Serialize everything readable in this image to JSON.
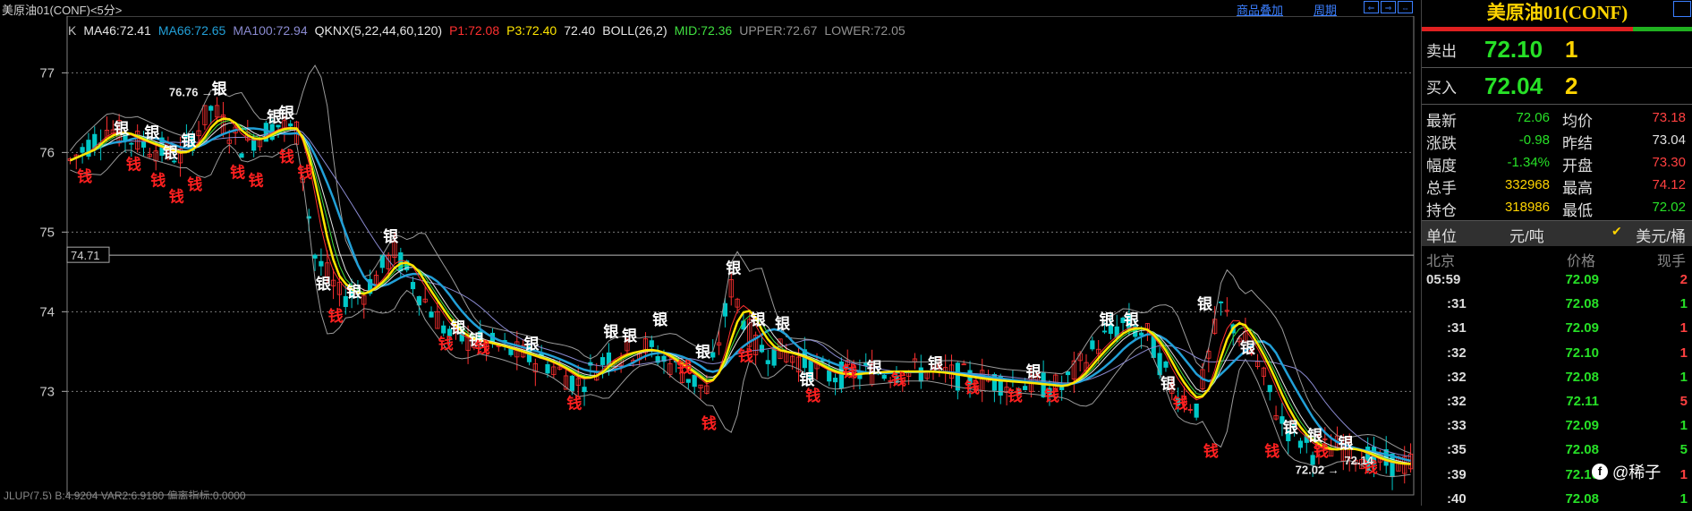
{
  "window": {
    "title": "美原油01(CONF)<5分>",
    "links": [
      "商品叠加",
      "周期"
    ],
    "window_buttons": [
      "⇐",
      "⇒",
      "⇔"
    ]
  },
  "indicators": [
    {
      "text": "K",
      "color": "#c0c0c0"
    },
    {
      "text": "MA46:72.41",
      "color": "#e6e6e6"
    },
    {
      "text": "MA66:72.65",
      "color": "#22a0d8"
    },
    {
      "text": "MA100:72.94",
      "color": "#8a8ad0"
    },
    {
      "text": "QKNX(5,22,44,60,120)",
      "color": "#e6e6e6"
    },
    {
      "text": "P1:72.08",
      "color": "#ff3030"
    },
    {
      "text": "P3:72.40",
      "color": "#ffe600"
    },
    {
      "text": "72.40",
      "color": "#e6e6e6"
    },
    {
      "text": "BOLL(26,2)",
      "color": "#e6e6e6"
    },
    {
      "text": "MID:72.36",
      "color": "#40e040"
    },
    {
      "text": "UPPER:72.67",
      "color": "#909090"
    },
    {
      "text": "LOWER:72.05",
      "color": "#909090"
    }
  ],
  "bottom_indicator_partial": "JLUP(7,5)  B:4.9204  VAR2:6.9180  偏离指标:0.0000",
  "chart_data": {
    "type": "line",
    "y_ticks": [
      77,
      76,
      75,
      74,
      73
    ],
    "ylim": [
      71.7,
      77.6
    ],
    "x_count": 220,
    "price_marker": "74.71",
    "annotations": [
      {
        "text": "76.76 →",
        "x": 22,
        "y": 76.76
      },
      {
        "text": "72.02 →",
        "x": 206,
        "y": 72.02
      },
      {
        "text": "72.14",
        "x": 214,
        "y": 72.14
      }
    ],
    "signals": [
      {
        "label": "银",
        "x": 8,
        "y": 76.3
      },
      {
        "label": "银",
        "x": 13,
        "y": 76.25
      },
      {
        "label": "银",
        "x": 16,
        "y": 76.0
      },
      {
        "label": "银",
        "x": 19,
        "y": 76.15
      },
      {
        "label": "银",
        "x": 24,
        "y": 76.8
      },
      {
        "label": "银",
        "x": 33,
        "y": 76.45
      },
      {
        "label": "银",
        "x": 35,
        "y": 76.5
      },
      {
        "label": "银",
        "x": 41,
        "y": 74.35
      },
      {
        "label": "银",
        "x": 46,
        "y": 74.25
      },
      {
        "label": "银",
        "x": 52,
        "y": 74.95
      },
      {
        "label": "银",
        "x": 63,
        "y": 73.8
      },
      {
        "label": "银",
        "x": 66,
        "y": 73.65
      },
      {
        "label": "银",
        "x": 75,
        "y": 73.6
      },
      {
        "label": "银",
        "x": 88,
        "y": 73.75
      },
      {
        "label": "银",
        "x": 91,
        "y": 73.7
      },
      {
        "label": "银",
        "x": 96,
        "y": 73.9
      },
      {
        "label": "银",
        "x": 103,
        "y": 73.5
      },
      {
        "label": "银",
        "x": 108,
        "y": 74.55
      },
      {
        "label": "银",
        "x": 112,
        "y": 73.9
      },
      {
        "label": "银",
        "x": 116,
        "y": 73.85
      },
      {
        "label": "银",
        "x": 120,
        "y": 73.15
      },
      {
        "label": "银",
        "x": 131,
        "y": 73.3
      },
      {
        "label": "银",
        "x": 141,
        "y": 73.35
      },
      {
        "label": "银",
        "x": 157,
        "y": 73.25
      },
      {
        "label": "银",
        "x": 169,
        "y": 73.9
      },
      {
        "label": "银",
        "x": 173,
        "y": 73.9
      },
      {
        "label": "银",
        "x": 179,
        "y": 73.1
      },
      {
        "label": "银",
        "x": 185,
        "y": 74.1
      },
      {
        "label": "银",
        "x": 192,
        "y": 73.55
      },
      {
        "label": "银",
        "x": 199,
        "y": 72.55
      },
      {
        "label": "银",
        "x": 203,
        "y": 72.45
      },
      {
        "label": "银",
        "x": 208,
        "y": 72.35
      },
      {
        "label": "钱",
        "x": 2,
        "y": 75.7
      },
      {
        "label": "钱",
        "x": 10,
        "y": 75.85
      },
      {
        "label": "钱",
        "x": 14,
        "y": 75.65
      },
      {
        "label": "钱",
        "x": 17,
        "y": 75.45
      },
      {
        "label": "钱",
        "x": 20,
        "y": 75.6
      },
      {
        "label": "钱",
        "x": 27,
        "y": 75.75
      },
      {
        "label": "钱",
        "x": 30,
        "y": 75.65
      },
      {
        "label": "钱",
        "x": 35,
        "y": 75.95
      },
      {
        "label": "钱",
        "x": 38,
        "y": 75.75
      },
      {
        "label": "钱",
        "x": 43,
        "y": 73.95
      },
      {
        "label": "钱",
        "x": 61,
        "y": 73.6
      },
      {
        "label": "钱",
        "x": 67,
        "y": 73.55
      },
      {
        "label": "钱",
        "x": 82,
        "y": 72.85
      },
      {
        "label": "钱",
        "x": 100,
        "y": 73.3
      },
      {
        "label": "钱",
        "x": 104,
        "y": 72.6
      },
      {
        "label": "钱",
        "x": 110,
        "y": 73.45
      },
      {
        "label": "钱",
        "x": 121,
        "y": 72.95
      },
      {
        "label": "钱",
        "x": 127,
        "y": 73.25
      },
      {
        "label": "钱",
        "x": 135,
        "y": 73.15
      },
      {
        "label": "钱",
        "x": 147,
        "y": 73.05
      },
      {
        "label": "钱",
        "x": 154,
        "y": 72.95
      },
      {
        "label": "钱",
        "x": 160,
        "y": 72.95
      },
      {
        "label": "钱",
        "x": 181,
        "y": 72.85
      },
      {
        "label": "钱",
        "x": 186,
        "y": 72.25
      },
      {
        "label": "钱",
        "x": 196,
        "y": 72.25
      },
      {
        "label": "钱",
        "x": 204,
        "y": 72.25
      },
      {
        "label": "钱",
        "x": 212,
        "y": 72.05
      }
    ]
  },
  "panel": {
    "title": "美原油01(CONF)",
    "sell": {
      "label": "卖出",
      "price": "72.10",
      "volume": "1"
    },
    "buy": {
      "label": "买入",
      "price": "72.04",
      "volume": "2"
    },
    "stats": [
      {
        "k1": "最新",
        "v1": "72.06",
        "c1": "#27e027",
        "k2": "均价",
        "v2": "73.18",
        "c2": "#ff4040"
      },
      {
        "k1": "涨跌",
        "v1": "-0.98",
        "c1": "#27e027",
        "k2": "昨结",
        "v2": "73.04",
        "c2": "#e0e0e0"
      },
      {
        "k1": "幅度",
        "v1": "-1.34%",
        "c1": "#27e027",
        "k2": "开盘",
        "v2": "73.30",
        "c2": "#ff4040"
      },
      {
        "k1": "总手",
        "v1": "332968",
        "c1": "#ffd400",
        "k2": "最高",
        "v2": "74.12",
        "c2": "#ff4040"
      },
      {
        "k1": "持仓",
        "v1": "318986",
        "c1": "#ffd400",
        "k2": "最低",
        "v2": "72.02",
        "c2": "#27e027"
      }
    ],
    "unit_label": "单位",
    "unit_value": "元/吨",
    "unit_alt": "美元/桶",
    "columns": [
      "北京",
      "价格",
      "现手"
    ],
    "ticks": [
      {
        "time": "05:59",
        "price": "72.09",
        "qty": "2",
        "qcolor": "#ff4040"
      },
      {
        "time": ":31",
        "price": "72.08",
        "qty": "1",
        "qcolor": "#27e027"
      },
      {
        "time": ":31",
        "price": "72.09",
        "qty": "1",
        "qcolor": "#ff4040"
      },
      {
        "time": ":32",
        "price": "72.10",
        "qty": "1",
        "qcolor": "#ff4040"
      },
      {
        "time": ":32",
        "price": "72.08",
        "qty": "1",
        "qcolor": "#27e027"
      },
      {
        "time": ":32",
        "price": "72.11",
        "qty": "5",
        "qcolor": "#ff4040"
      },
      {
        "time": ":33",
        "price": "72.09",
        "qty": "1",
        "qcolor": "#27e027"
      },
      {
        "time": ":35",
        "price": "72.08",
        "qty": "5",
        "qcolor": "#27e027"
      },
      {
        "time": ":39",
        "price": "72.10",
        "qty": "1",
        "qcolor": "#ff4040"
      },
      {
        "time": ":40",
        "price": "72.08",
        "qty": "1",
        "qcolor": "#27e027"
      }
    ]
  },
  "watermark": "@稀子"
}
